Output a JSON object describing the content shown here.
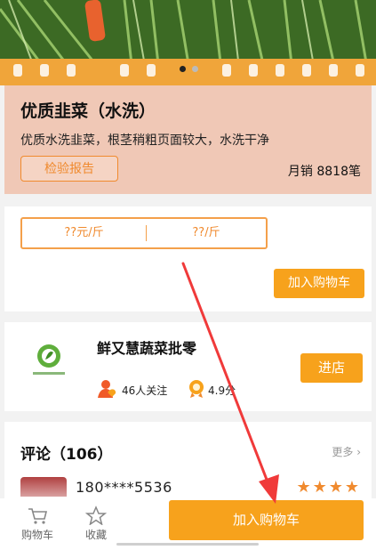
{
  "hero": {
    "slide_count": 2,
    "active_slide": 1
  },
  "product": {
    "title": "优质韭菜（水洗）",
    "description": "优质水洗韭菜，根茎稍粗页面较大，水洗干净",
    "inspection_button": "检验报告",
    "sales": "月销 8818笔"
  },
  "price": {
    "unit_price": "??元/斤",
    "alt_price": "??/斤",
    "add_to_cart": "加入购物车"
  },
  "store": {
    "name": "鲜又慧蔬菜批零",
    "followers": "46人关注",
    "rating": "4.9分",
    "enter_button": "进店",
    "logo_text": "鲜又慧蔬菜批零"
  },
  "comments": {
    "title": "评论（106）",
    "more": "更多",
    "user": "180****5536",
    "stars": "★★★★"
  },
  "bottom_bar": {
    "cart_label": "购物车",
    "favorite_label": "收藏",
    "add_to_cart": "加入购物车"
  },
  "colors": {
    "accent_orange": "#f7a21c",
    "product_bg": "#f0c8b6",
    "annotation_red": "#f03a3a"
  }
}
